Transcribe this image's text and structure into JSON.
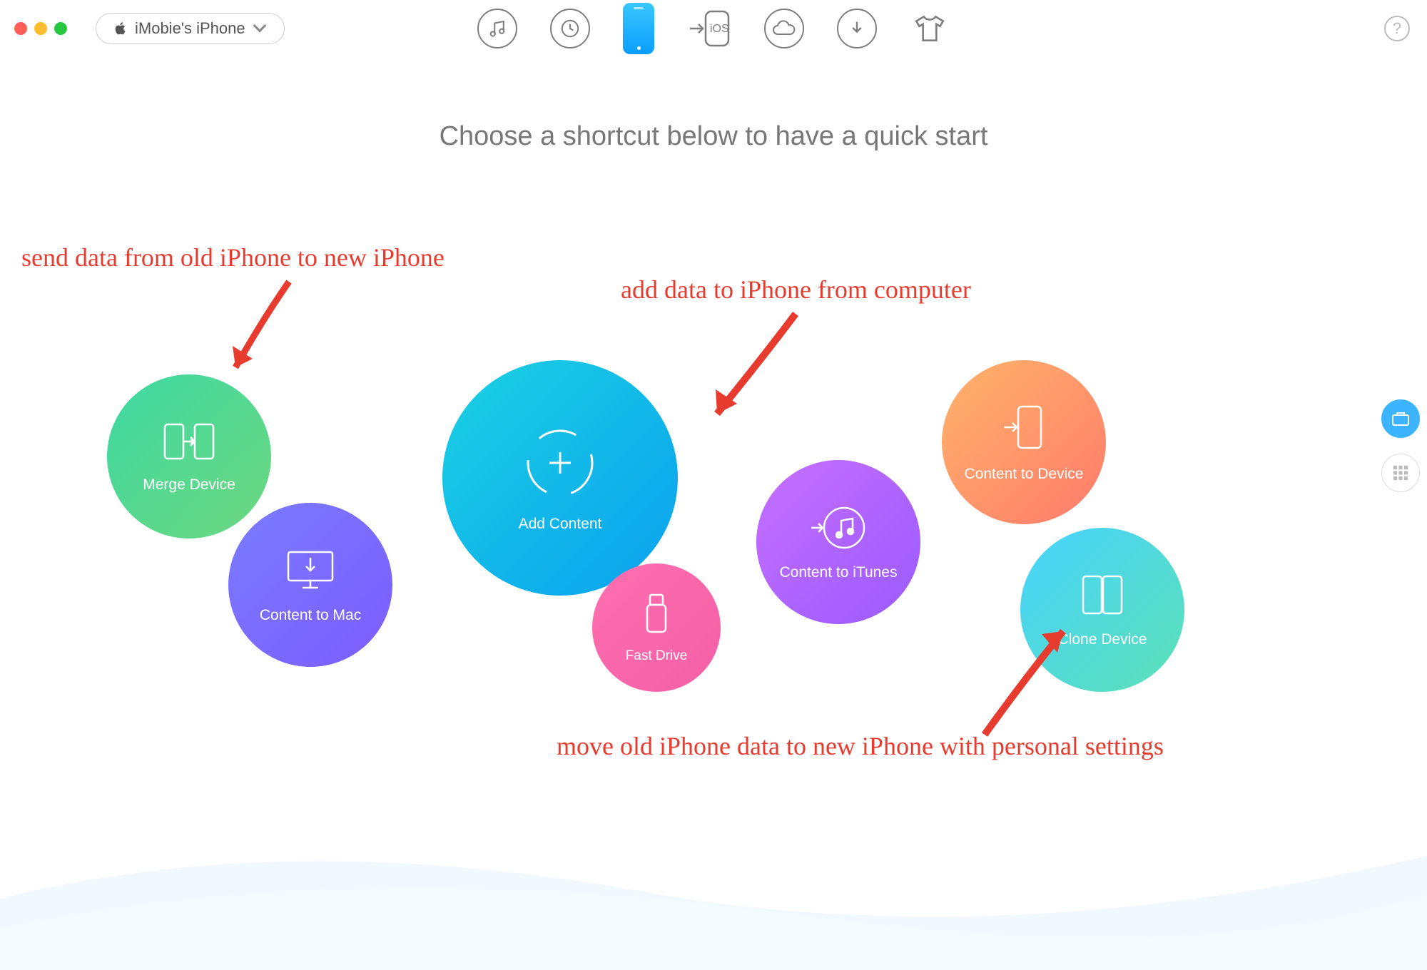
{
  "toolbar": {
    "device_label": "iMobie's iPhone"
  },
  "heading": "Choose a shortcut below to have a quick start",
  "bubbles": {
    "merge": "Merge Device",
    "mac": "Content to Mac",
    "add": "Add Content",
    "fast": "Fast Drive",
    "itunes": "Content to iTunes",
    "device": "Content to Device",
    "clone": "Clone Device"
  },
  "annotations": {
    "a1": "send data from old iPhone to new iPhone",
    "a2": "add data to iPhone from computer",
    "a3": "move old iPhone data to new iPhone with personal settings"
  },
  "help": "?"
}
